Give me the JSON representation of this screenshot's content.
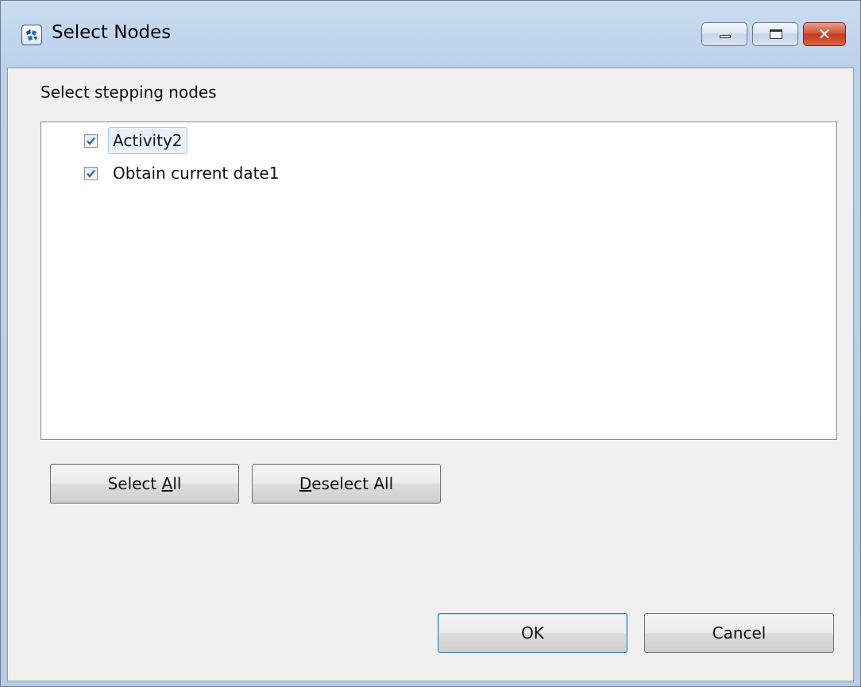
{
  "window": {
    "title": "Select Nodes",
    "close_glyph": "✕"
  },
  "dialog": {
    "instruction": "Select stepping nodes",
    "nodes": [
      {
        "label": "Activity2",
        "checked": true,
        "focused": true
      },
      {
        "label": "Obtain current date1",
        "checked": true,
        "focused": false
      }
    ],
    "select_all": {
      "before": "Select ",
      "mnemonic": "A",
      "after": "ll"
    },
    "deselect_all": {
      "before": "",
      "mnemonic": "D",
      "after": "eselect All"
    },
    "ok_label": "OK",
    "cancel_label": "Cancel"
  },
  "icons": {
    "app": "app-logo-icon",
    "minimize": "minimize-icon",
    "maximize": "maximize-icon",
    "close": "close-icon",
    "checkmark": "checkmark-icon"
  },
  "colors": {
    "titlebar": "#c9dcf1",
    "client_bg": "#f0f0f0",
    "close_button": "#c23a20",
    "check_mark": "#3c5d9e"
  }
}
